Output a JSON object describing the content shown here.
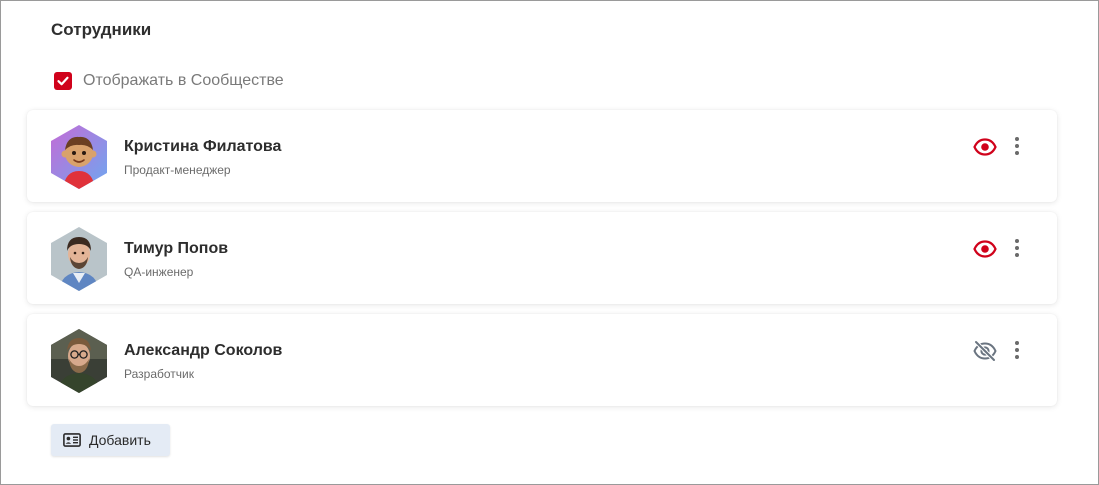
{
  "section": {
    "title": "Сотрудники",
    "show_in_community_label": "Отображать в Сообществе",
    "show_in_community_checked": true
  },
  "employees": [
    {
      "name": "Кристина Филатова",
      "role": "Продакт-менеджер",
      "visible": true,
      "avatar": "cartoon-avatar"
    },
    {
      "name": "Тимур Попов",
      "role": "QA-инженер",
      "visible": true,
      "avatar": "photo-avatar"
    },
    {
      "name": "Александр Соколов",
      "role": "Разработчик",
      "visible": false,
      "avatar": "photo-avatar"
    }
  ],
  "add_button": {
    "label": "Добавить",
    "icon": "id-card-icon"
  },
  "icons": {
    "visible": "eye-icon",
    "hidden": "eye-off-icon",
    "menu": "more-vert-icon"
  },
  "colors": {
    "accent": "#d0021b",
    "muted_icon": "#6a6a6a",
    "button_bg": "#e4ebf5"
  }
}
